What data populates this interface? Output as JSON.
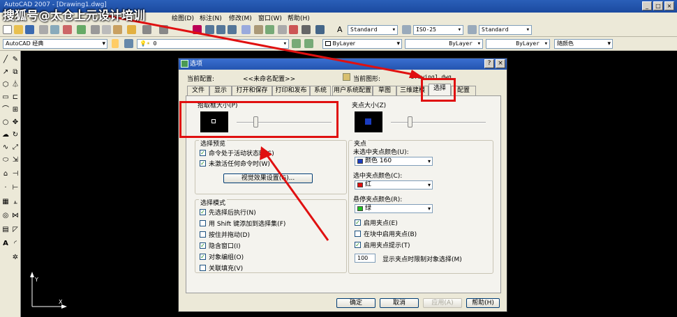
{
  "app": {
    "title": "AutoCAD 2007 - [Drawing1.dwg]",
    "watermark": "搜狐号@太仓上元设计培训"
  },
  "menubar": [
    "绘图(D)",
    "标注(N)",
    "修改(M)",
    "窗口(W)",
    "帮助(H)"
  ],
  "toolbar1": {
    "text_style": "Standard",
    "dim_style": "ISO-25",
    "table_style": "Standard"
  },
  "toolbar2": {
    "workspace": "AutoCAD 经典",
    "layer": "0",
    "color": "ByLayer",
    "linetype": "ByLayer",
    "lineweight": "ByLayer",
    "plotstyle": "随颜色"
  },
  "dialog": {
    "title": "选项",
    "current_profile_label": "当前配置:",
    "current_profile_value": "<<未命名配置>>",
    "current_drawing_label": "当前图形:",
    "current_drawing_value": "Drawing1.dwg",
    "tabs": [
      "文件",
      "显示",
      "打开和保存",
      "打印和发布",
      "系统",
      "用户系统配置",
      "草图",
      "三维建模",
      "选择",
      "配置"
    ],
    "active_tab": "选择",
    "pickbox": {
      "title": "拾取框大小(P)",
      "level": 0.2
    },
    "gripsize": {
      "title": "夹点大小(Z)",
      "level": 0.2,
      "color": "#1a3cc0"
    },
    "preview": {
      "title": "选择预览",
      "opt1": "命令处于活动状态时(S)",
      "opt2": "未激活任何命令时(W)",
      "button": "视觉效果设置(G)..."
    },
    "modes": {
      "title": "选择模式",
      "items": [
        {
          "label": "先选择后执行(N)",
          "checked": true
        },
        {
          "label": "用 Shift 键添加到选择集(F)",
          "checked": false
        },
        {
          "label": "按住并拖动(D)",
          "checked": false
        },
        {
          "label": "隐含窗口(I)",
          "checked": true
        },
        {
          "label": "对象编组(O)",
          "checked": true
        },
        {
          "label": "关联填充(V)",
          "checked": false
        }
      ]
    },
    "grips": {
      "title": "夹点",
      "unselected_label": "未选中夹点颜色(U):",
      "unselected_value": "颜色 160",
      "unselected_color": "#1a3cc0",
      "selected_label": "选中夹点颜色(C):",
      "selected_value": "红",
      "selected_color": "#e01010",
      "hover_label": "悬停夹点颜色(R):",
      "hover_value": "绿",
      "hover_color": "#20c020",
      "enable": "启用夹点(E)",
      "enable_in_blocks": "在块中启用夹点(B)",
      "enable_tips": "启用夹点提示(T)",
      "limit_value": "100",
      "limit_label": "显示夹点时限制对象选择(M)"
    },
    "buttons": {
      "ok": "确定",
      "cancel": "取消",
      "apply": "应用(A)",
      "help": "帮助(H)"
    }
  }
}
